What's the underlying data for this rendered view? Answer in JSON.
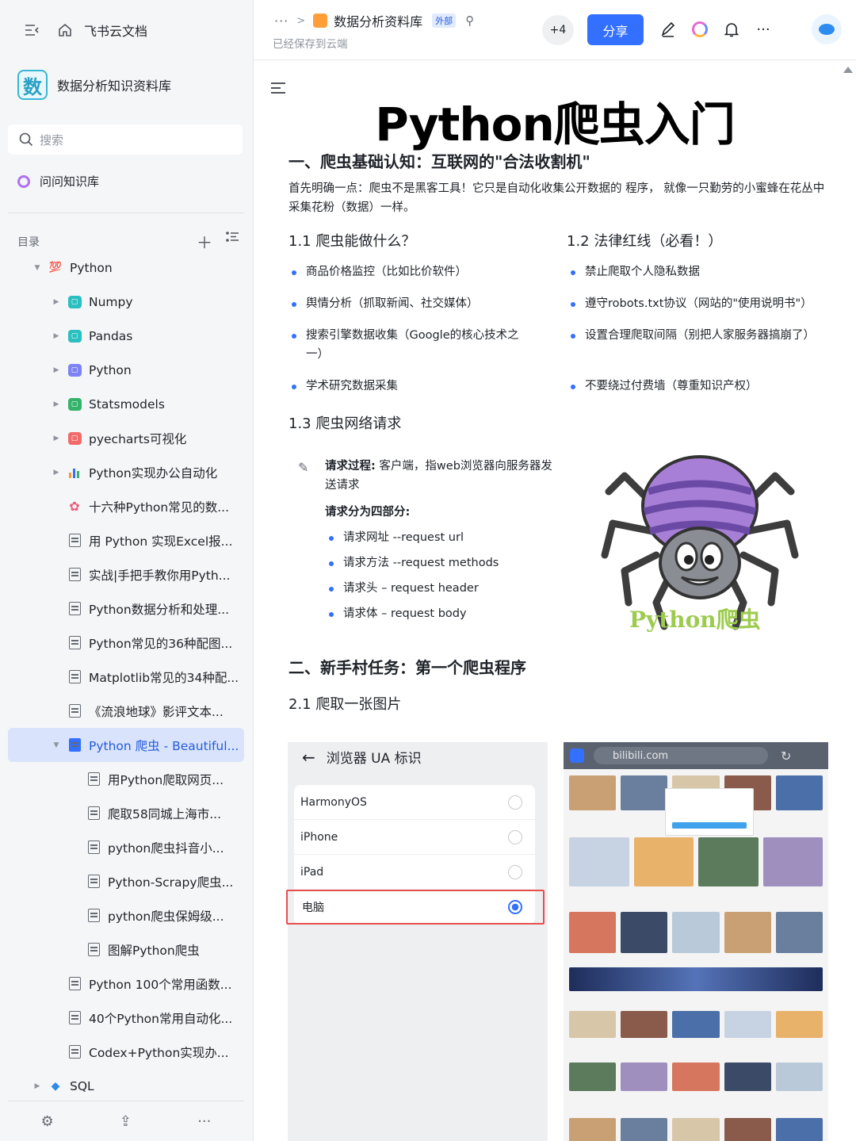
{
  "sidebar": {
    "brand": "飞书云文档",
    "kb_logo_char": "数",
    "kb_name": "数据分析知识资料库",
    "search_placeholder": "搜索",
    "ask_label": "问问知识库",
    "toc_label": "目录",
    "tree": [
      {
        "label": "Python",
        "level": 0,
        "caret": "down",
        "icon": "emoji-100"
      },
      {
        "label": "Numpy",
        "level": 1,
        "caret": "right",
        "icon": "sheet",
        "color": "#2bbfbf"
      },
      {
        "label": "Pandas",
        "level": 1,
        "caret": "right",
        "icon": "sheet",
        "color": "#2bbfbf"
      },
      {
        "label": "Python",
        "level": 1,
        "caret": "right",
        "icon": "sheet",
        "color": "#7c83f5"
      },
      {
        "label": "Statsmodels",
        "level": 1,
        "caret": "right",
        "icon": "sheet",
        "color": "#34b36b"
      },
      {
        "label": "pyecharts可视化",
        "level": 1,
        "caret": "right",
        "icon": "sheet",
        "color": "#f26b6b"
      },
      {
        "label": "Python实现办公自动化",
        "level": 1,
        "caret": "right",
        "icon": "bar-chart"
      },
      {
        "label": "十六种Python常见的数...",
        "level": 1,
        "caret": "",
        "icon": "flower"
      },
      {
        "label": "用 Python 实现Excel报...",
        "level": 1,
        "caret": "",
        "icon": "doc"
      },
      {
        "label": "实战|手把手教你用Pyth...",
        "level": 1,
        "caret": "",
        "icon": "doc"
      },
      {
        "label": "Python数据分析和处理...",
        "level": 1,
        "caret": "",
        "icon": "doc"
      },
      {
        "label": "Python常见的36种配图...",
        "level": 1,
        "caret": "",
        "icon": "doc"
      },
      {
        "label": "Matplotlib常见的34种配...",
        "level": 1,
        "caret": "",
        "icon": "doc"
      },
      {
        "label": "《流浪地球》影评文本...",
        "level": 1,
        "caret": "",
        "icon": "doc"
      },
      {
        "label": "Python 爬虫 - Beautiful...",
        "level": 1,
        "caret": "down",
        "icon": "doc-blue",
        "active": true
      },
      {
        "label": "用Python爬取网页...",
        "level": 2,
        "caret": "",
        "icon": "doc"
      },
      {
        "label": "爬取58同城上海市...",
        "level": 2,
        "caret": "",
        "icon": "doc"
      },
      {
        "label": "python爬虫抖音小...",
        "level": 2,
        "caret": "",
        "icon": "doc"
      },
      {
        "label": "Python-Scrapy爬虫...",
        "level": 2,
        "caret": "",
        "icon": "doc"
      },
      {
        "label": "python爬虫保姆级...",
        "level": 2,
        "caret": "",
        "icon": "doc"
      },
      {
        "label": "图解Python爬虫",
        "level": 2,
        "caret": "",
        "icon": "doc"
      },
      {
        "label": "Python 100个常用函数...",
        "level": 1,
        "caret": "",
        "icon": "doc"
      },
      {
        "label": "40个Python常用自动化...",
        "level": 1,
        "caret": "",
        "icon": "doc"
      },
      {
        "label": "Codex+Python实现办...",
        "level": 1,
        "caret": "",
        "icon": "doc"
      },
      {
        "label": "SQL",
        "level": 0,
        "caret": "right",
        "icon": "gem"
      }
    ]
  },
  "header": {
    "breadcrumb_more": "···",
    "breadcrumb_title": "数据分析资料库",
    "external_tag": "外部",
    "saved_status": "已经保存到云端",
    "collaborators": "+4",
    "share_label": "分享",
    "more_label": "···"
  },
  "doc": {
    "title": "Python爬虫入门",
    "s1_heading": "一、爬虫基础认知：互联网的\"合法收割机\"",
    "s1_para": "首先明确一点：爬虫不是黑客工具！它只是自动化收集公开数据的 程序， 就像一只勤劳的小蜜蜂在花丛中采集花粉（数据）一样。",
    "s11_heading": "1.1 爬虫能做什么？",
    "s11_items": [
      "商品价格监控（比如比价软件）",
      "舆情分析（抓取新闻、社交媒体）",
      "搜索引擎数据收集（Google的核心技术之一）",
      "学术研究数据采集"
    ],
    "s12_heading": "1.2 法律红线（必看！）",
    "s12_items": [
      "禁止爬取个人隐私数据",
      "遵守robots.txt协议（网站的\"使用说明书\"）",
      "设置合理爬取间隔（别把人家服务器搞崩了）",
      "不要绕过付费墙（尊重知识产权）"
    ],
    "s13_heading": "1.3 爬虫网络请求",
    "callout_bold": "请求过程:",
    "callout_text": " 客户端，指web浏览器向服务器发送请求",
    "callout_sub": "请求分为四部分:",
    "callout_items": [
      "请求网址 --request url",
      "请求方法 --request methods",
      "请求头 – request header",
      "请求体 – request body"
    ],
    "spider_caption": "Python爬虫",
    "s2_heading": "二、新手村任务：第一个爬虫程序",
    "s21_heading": "2.1 爬取一张图片",
    "phone": {
      "title": "浏览器 UA 标识",
      "options": [
        "HarmonyOS",
        "iPhone",
        "iPad",
        "电脑"
      ],
      "selected": "电脑"
    },
    "browser": {
      "url": "bilibili.com"
    }
  },
  "colors": {
    "accent": "#3370ff",
    "active_bg": "#d9e3fb",
    "spider_caption": "#9ccb4e"
  }
}
